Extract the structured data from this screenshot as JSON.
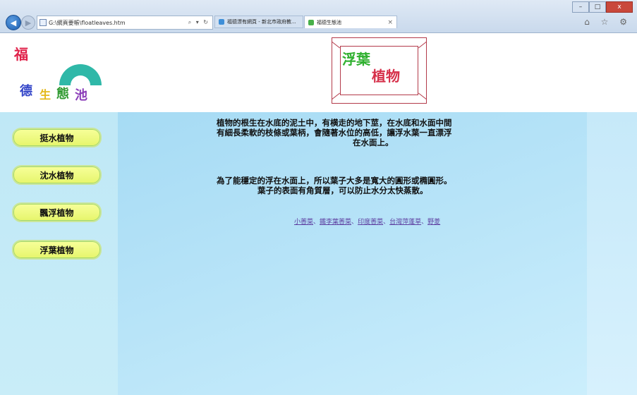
{
  "browser": {
    "address": "G:\\網頁要帳\\floatleaves.htm",
    "address_icons": "⌕ ▾ ↻",
    "tabs": [
      {
        "label": "福德漂有網頁 - 新北市政府教..."
      },
      {
        "label": "福德生態池"
      }
    ],
    "tab_close": "×",
    "window_controls": [
      "–",
      "□",
      "x"
    ],
    "toolbar_icons": "⌂ ☆ ⚙"
  },
  "header": {
    "logo_chars": [
      "福",
      "德",
      "生",
      "態",
      "池"
    ],
    "title_line1": "浮葉",
    "title_line2": "植物"
  },
  "sidebar": {
    "items": [
      {
        "label": "挺水植物"
      },
      {
        "label": "沈水植物"
      },
      {
        "label": "飄浮植物"
      },
      {
        "label": "浮葉植物"
      }
    ]
  },
  "content": {
    "paragraph1": [
      "植物的根生在水底的泥土中，有横走的地下莖，在水底和水面中間",
      "有細長柔軟的枝條或葉柄，會隨著水位的高低，讓浮水葉一直漂浮",
      "在水面上。"
    ],
    "paragraph2": [
      "為了能穩定的浮在水面上，所以葉子大多是寬大的圓形或橢圓形。",
      "葉子的表面有角質層，可以防止水分太快蒸散。"
    ],
    "links": [
      "小莕菜",
      "鐵李葉莕菜",
      "印度莕菜",
      "台灣萍蓬草",
      "野菱"
    ],
    "link_separator": "、"
  },
  "colors": {
    "sidebar_bg": "#bfe8f6",
    "content_bg": "#a6dbf4",
    "button_fill": "#f0fb80",
    "title_frame": "#b33a4a",
    "link": "#5d3ea0"
  }
}
